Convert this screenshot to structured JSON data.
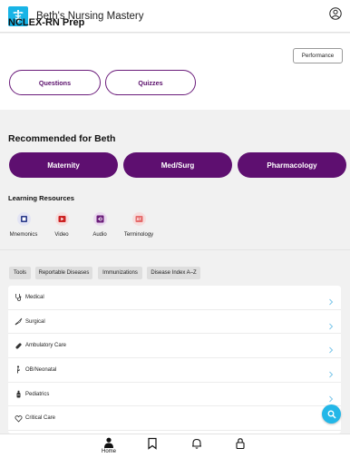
{
  "header": {
    "app_title": "Beth's Nursing Mastery",
    "logo_icon": "caduceus-icon",
    "profile_icon": "account-icon"
  },
  "prep": {
    "title": "NCLEX-RN Prep",
    "performance_label": "Performance",
    "questions_label": "Questions",
    "quizzes_label": "Quizzes"
  },
  "recommended": {
    "title": "Recommended for Beth",
    "items": [
      "Maternity",
      "Med/Surg",
      "Pharmacology"
    ]
  },
  "learning_resources": {
    "title": "Learning Resources",
    "items": [
      {
        "label": "Mnemonics",
        "icon": "mnemonics-icon"
      },
      {
        "label": "Video",
        "icon": "video-icon"
      },
      {
        "label": "Audio",
        "icon": "audio-icon"
      },
      {
        "label": "Terminology",
        "icon": "terminology-icon"
      }
    ]
  },
  "tools_tabs": [
    "Tools",
    "Reportable Diseases",
    "Immunizations",
    "Disease Index A–Z"
  ],
  "categories": [
    {
      "label": "Medical",
      "icon": "stethoscope-icon"
    },
    {
      "label": "Surgical",
      "icon": "scalpel-icon"
    },
    {
      "label": "Ambulatory Care",
      "icon": "bandage-icon"
    },
    {
      "label": "OB/Neonatal",
      "icon": "pregnancy-icon"
    },
    {
      "label": "Pediatrics",
      "icon": "baby-bottle-icon"
    },
    {
      "label": "Critical Care",
      "icon": "heart-monitor-icon"
    }
  ],
  "bottom_nav": {
    "home_label": "Home"
  },
  "colors": {
    "brand_purple": "#5e0f70",
    "accent_blue": "#23b7e8",
    "logo_blue": "#18b4e6"
  }
}
